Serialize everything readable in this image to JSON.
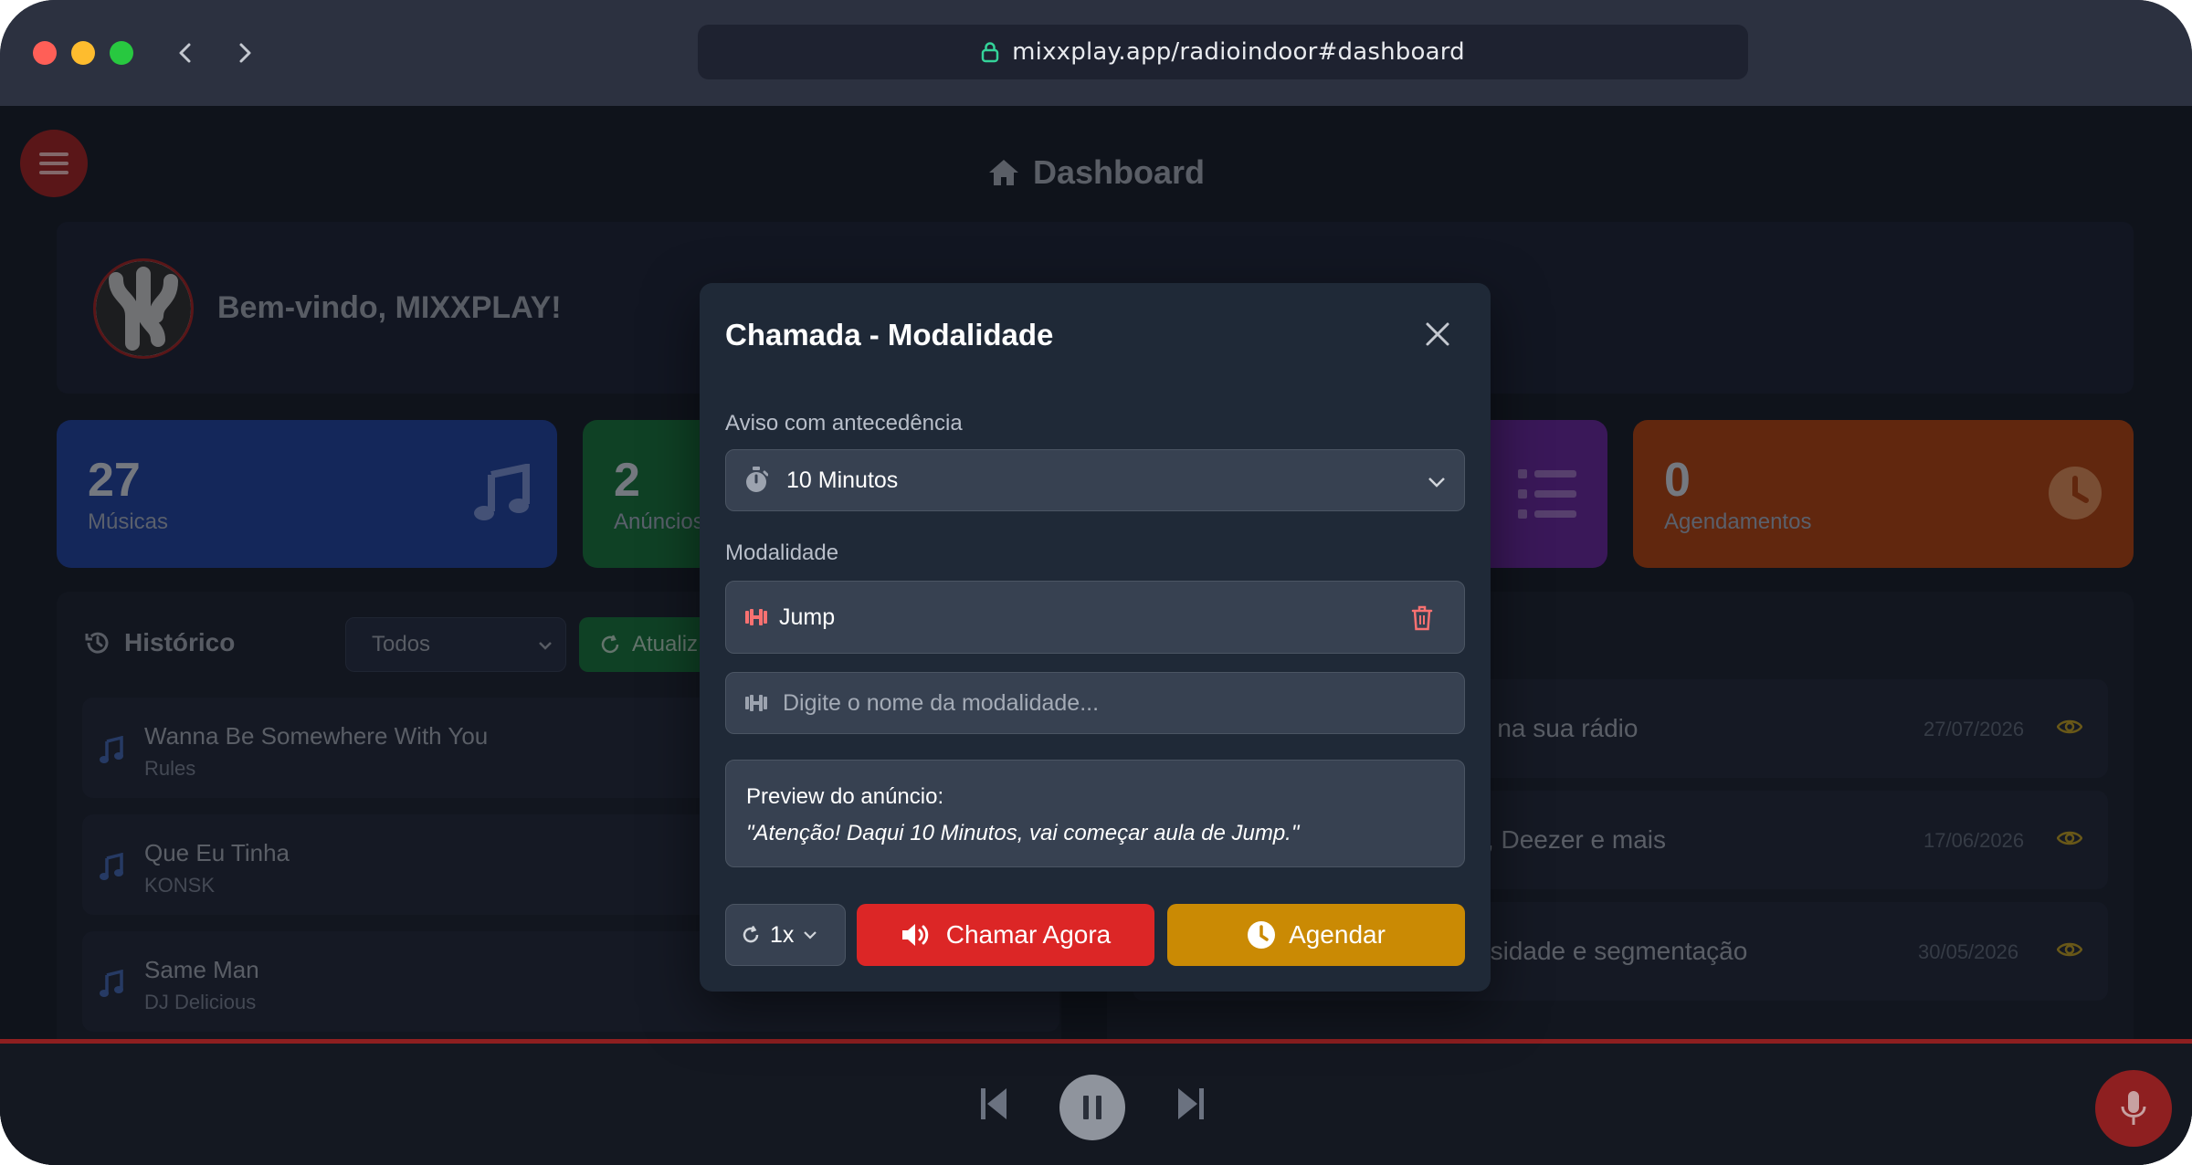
{
  "browser": {
    "url": "mixxplay.app/radioindoor#dashboard",
    "back_icon": "chevron-left-icon",
    "forward_icon": "chevron-right-icon"
  },
  "page": {
    "title": "Dashboard",
    "welcome": "Bem-vindo, MIXXPLAY!"
  },
  "stats": [
    {
      "value": "27",
      "label": "Músicas",
      "color": "#1e3a8a",
      "icon": "music-note-icon"
    },
    {
      "value": "2",
      "label": "Anúncios",
      "color": "#166534"
    },
    {
      "value": "",
      "label": "",
      "color": "#5b2288",
      "icon": "list-icon"
    },
    {
      "value": "0",
      "label": "Agendamentos",
      "color": "#9a3a0f",
      "icon": "clock-icon"
    }
  ],
  "history": {
    "title": "Histórico",
    "filter": "Todos",
    "refresh_label": "Atualiz",
    "items": [
      {
        "title": "Wanna Be Somewhere With You",
        "artist": "Rules"
      },
      {
        "title": "Que Eu Tinha",
        "artist": "KONSK"
      },
      {
        "title": "Same Man",
        "artist": "DJ Delicious"
      }
    ]
  },
  "announcements": [
    {
      "text": "o na sua rádio",
      "date": "27/07/2026"
    },
    {
      "text": "y, Deezer e mais",
      "date": "17/06/2026"
    },
    {
      "text": "nsidade e segmentação",
      "date": "30/05/2026"
    }
  ],
  "modal": {
    "title": "Chamada - Modalidade",
    "advance_label": "Aviso com antecedência",
    "advance_value": "10 Minutos",
    "modality_label": "Modalidade",
    "modality_item": "Jump",
    "input_placeholder": "Digite o nome da modalidade...",
    "preview_label": "Preview do anúncio:",
    "preview_text": "\"Atenção! Daqui 10 Minutos, vai começar aula de Jump.\"",
    "repeat_value": "1x",
    "call_now_label": "Chamar Agora",
    "schedule_label": "Agendar"
  },
  "colors": {
    "brand_red": "#8e1f20",
    "call_red": "#dc2626",
    "schedule_amber": "#ca8a04",
    "eye_yellow": "#a68a1f"
  }
}
